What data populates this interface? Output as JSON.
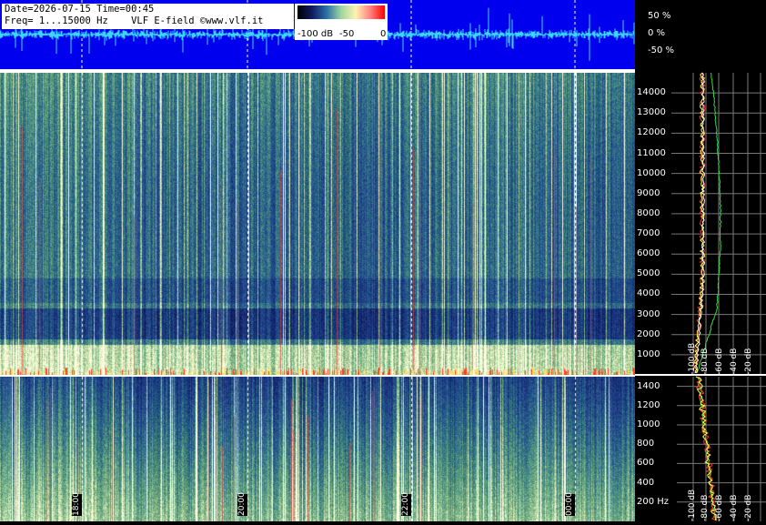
{
  "header": {
    "line1": "Date=2026-07-15 Time=00:45",
    "line2": "Freq= 1...15000 Hz    VLF E-field ©www.vlf.it"
  },
  "colorbar": {
    "labels": [
      "-100 dB",
      "-50",
      "0"
    ],
    "colors": [
      "#000000",
      "#101a60",
      "#2a6fa8",
      "#9fd6a0",
      "#fff2b0",
      "#ff8080",
      "#ff0000"
    ]
  },
  "colors": {
    "waveform_bg": "#0000ee",
    "waveform_trace": "#3ad6ff",
    "spectrum_white": "#ffffff",
    "spectrum_red": "#ff3b30",
    "spectrum_yellow": "#ffff40",
    "spectrum_green": "#30e040"
  },
  "chart_data": [
    {
      "type": "line",
      "panel": "waveform",
      "y_labels": [
        "50 %",
        "0 %",
        "-50 %"
      ],
      "ylim": [
        -100,
        100
      ]
    },
    {
      "type": "heatmap",
      "panel": "spectrogram-high",
      "y_ticks": [
        "14000",
        "13000",
        "12000",
        "11000",
        "10000",
        "9000",
        "8000",
        "7000",
        "6000",
        "5000",
        "4000",
        "3000",
        "2000",
        "1000"
      ],
      "ylim": [
        0,
        15000
      ]
    },
    {
      "type": "heatmap",
      "panel": "spectrogram-low",
      "y_ticks": [
        "1400",
        "1200",
        "1000",
        "800",
        "600",
        "400",
        "200 Hz"
      ],
      "ylim": [
        0,
        1500
      ]
    },
    {
      "type": "line",
      "panel": "spectrum-profiles",
      "x_ticks_high": [
        "-100 dB",
        "-80 dB",
        "-60 dB",
        "-40 dB",
        "-20 dB"
      ],
      "x_ticks_low": [
        "-100 dB",
        "-80 dB",
        "-60 dB",
        "-40 dB",
        "-20 dB"
      ]
    },
    {
      "type": "heatmap",
      "panel": "time-axis",
      "x_ticks": [
        "18:00",
        "20:00",
        "22:00",
        "00:00"
      ]
    }
  ]
}
